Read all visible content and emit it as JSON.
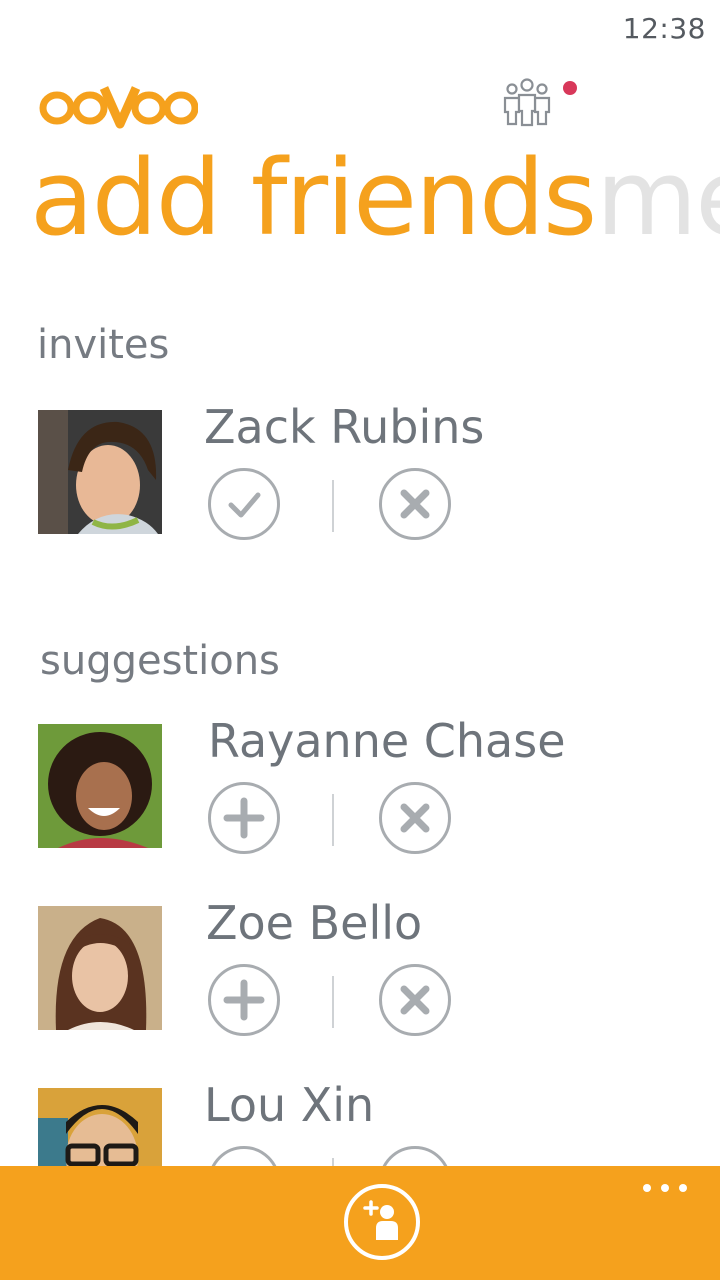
{
  "status_bar": {
    "time": "12:38"
  },
  "header": {
    "logo_text": "ooVoo",
    "group_icon": "people-group-icon",
    "has_notification": true
  },
  "pivot": {
    "active_title": "add friends",
    "next_title": "me"
  },
  "invites": {
    "title": "invites",
    "items": [
      {
        "name": "Zack Rubins",
        "accept_icon": "check-icon",
        "reject_icon": "close-icon"
      }
    ]
  },
  "suggestions": {
    "title": "suggestions",
    "items": [
      {
        "name": "Rayanne Chase",
        "accept_icon": "plus-icon",
        "reject_icon": "close-icon"
      },
      {
        "name": "Zoe Bello",
        "accept_icon": "plus-icon",
        "reject_icon": "close-icon"
      },
      {
        "name": "Lou Xin",
        "accept_icon": "plus-icon",
        "reject_icon": "close-icon"
      }
    ]
  },
  "app_bar": {
    "primary_icon": "add-friend-icon",
    "more_icon": "more-dots-icon"
  },
  "colors": {
    "accent": "#f5a11d",
    "notification": "#d8385a",
    "text_gray": "#6e747b"
  }
}
